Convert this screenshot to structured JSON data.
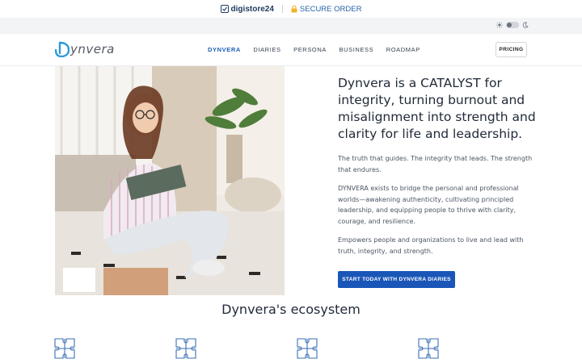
{
  "top_bar": {
    "brand": "digistore24",
    "secure_order": "SECURE ORDER"
  },
  "nav": {
    "logo_text": "ynvera",
    "items": [
      {
        "label": "DYNVERA",
        "active": true
      },
      {
        "label": "DIARIES",
        "active": false
      },
      {
        "label": "PERSONA",
        "active": false
      },
      {
        "label": "BUSINESS",
        "active": false
      },
      {
        "label": "ROADMAP",
        "active": false
      }
    ],
    "pricing": "PRICING"
  },
  "hero": {
    "headline": "Dynvera is a CATALYST for integrity, turning burnout and misalignment into strength and clarity for life and leadership.",
    "paragraphs": [
      "The truth that guides. The integrity that leads. The strength that endures.",
      "DYNVERA exists to bridge the personal and professional worlds—awakening authenticity, cultivating principled leadership, and equipping people to thrive with clarity, courage, and resilience.",
      "Empowers people and organizations to live and lead with truth, integrity, and strength."
    ],
    "cta": "START TODAY WITH DYNVERA DIARIES"
  },
  "ecosystem": {
    "title": "Dynvera's ecosystem",
    "icons": [
      "puzzle-icon",
      "puzzle-icon",
      "puzzle-icon",
      "puzzle-icon"
    ]
  },
  "colors": {
    "accent": "#1a56b8",
    "nav_active": "#1d5fb8"
  }
}
